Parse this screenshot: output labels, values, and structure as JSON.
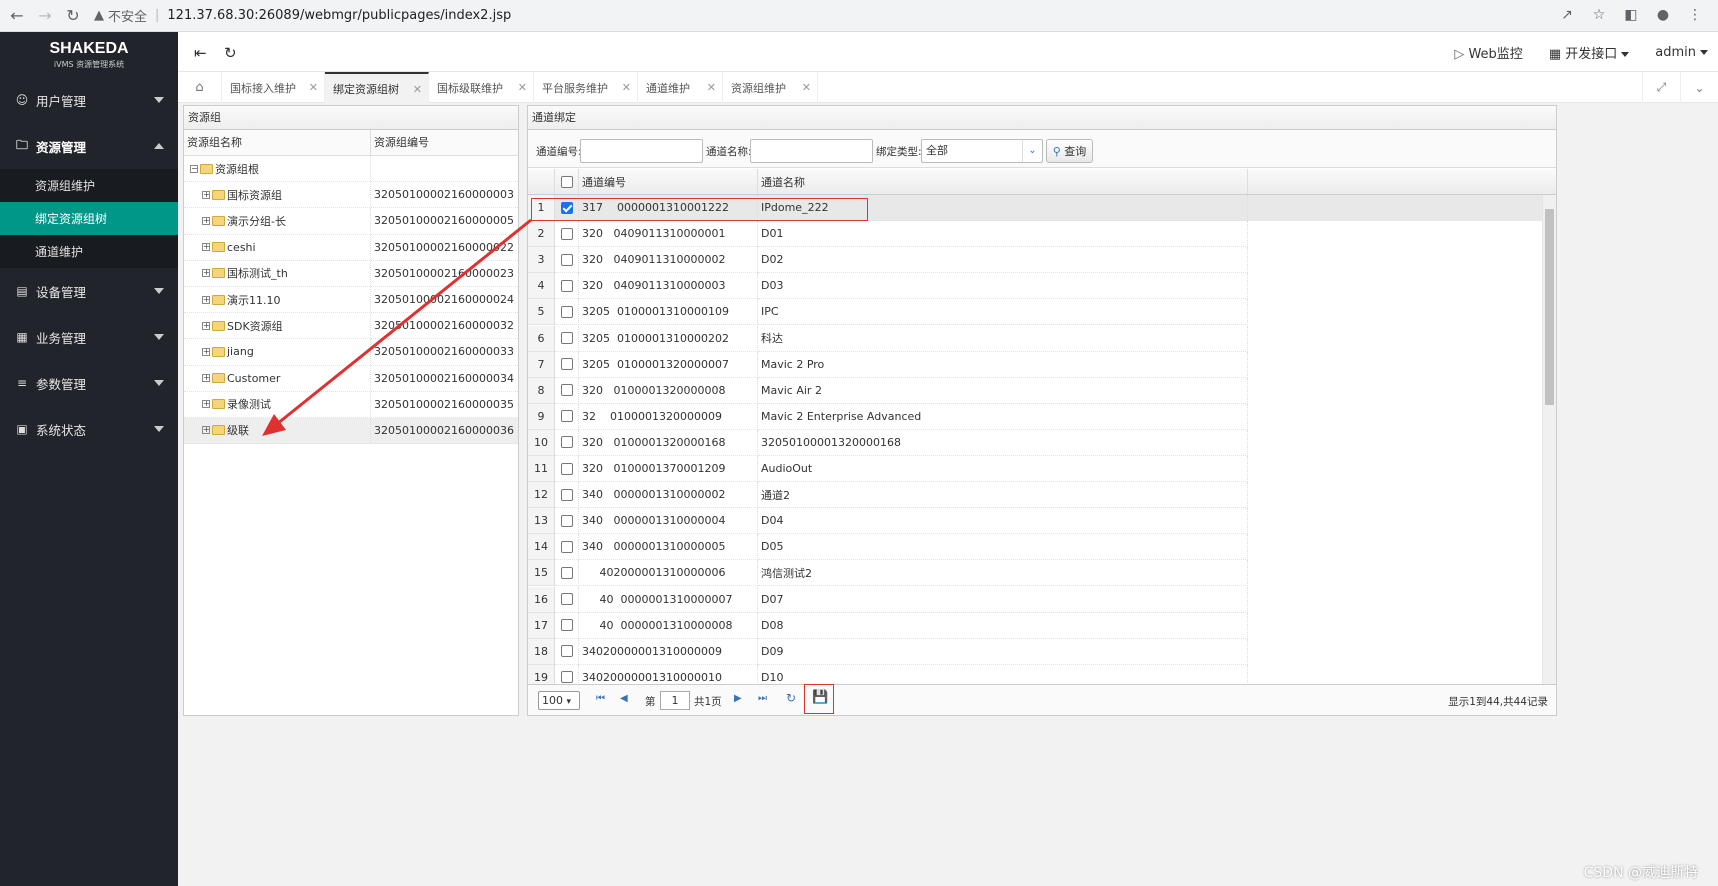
{
  "browser": {
    "insecure_label": "不安全",
    "url": "121.37.68.30:26089/webmgr/publicpages/index2.jsp"
  },
  "app": {
    "logo_main": "SHAKEDA",
    "logo_sub": "iVMS 资源管理系统"
  },
  "sidebar": {
    "items": [
      {
        "label": "用户管理",
        "icon": "user-icon",
        "expanded": false
      },
      {
        "label": "资源管理",
        "icon": "folder-icon",
        "expanded": true
      },
      {
        "label": "设备管理",
        "icon": "device-icon",
        "expanded": false
      },
      {
        "label": "业务管理",
        "icon": "business-icon",
        "expanded": false
      },
      {
        "label": "参数管理",
        "icon": "sliders-icon",
        "expanded": false
      },
      {
        "label": "系统状态",
        "icon": "monitor-icon",
        "expanded": false
      }
    ],
    "subitems": [
      {
        "label": "资源组维护",
        "selected": false
      },
      {
        "label": "绑定资源组树",
        "selected": true
      },
      {
        "label": "通道维护",
        "selected": false
      }
    ],
    "active_color": "#009688"
  },
  "topbar": {
    "web_monitor": "Web监控",
    "dev_api": "开发接口",
    "user": "admin"
  },
  "tabs": [
    {
      "label": "国标接入维护",
      "active": false
    },
    {
      "label": "绑定资源组树",
      "active": true
    },
    {
      "label": "国标级联维护",
      "active": false
    },
    {
      "label": "平台服务维护",
      "active": false
    },
    {
      "label": "通道维护",
      "active": false
    },
    {
      "label": "资源组维护",
      "active": false
    }
  ],
  "left_panel": {
    "title": "资源组",
    "col_name": "资源组名称",
    "col_code": "资源组编号",
    "root": "资源组根",
    "rows": [
      {
        "name": "国标资源组",
        "code": "32050100002160000003"
      },
      {
        "name": "演示分组-长",
        "code": "32050100002160000005"
      },
      {
        "name": "ceshi",
        "code": "32050100002160000022"
      },
      {
        "name": "国标测试_th",
        "code": "32050100002160000023"
      },
      {
        "name": "演示11.10",
        "code": "32050100002160000024"
      },
      {
        "name": "SDK资源组",
        "code": "32050100002160000032"
      },
      {
        "name": "jiang",
        "code": "32050100002160000033"
      },
      {
        "name": "Customer",
        "code": "32050100002160000034"
      },
      {
        "name": "录像测试",
        "code": "32050100002160000035"
      },
      {
        "name": "级联",
        "code": "32050100002160000036"
      }
    ]
  },
  "right_panel": {
    "title": "通道绑定",
    "filter": {
      "channel_code_label": "通道编号:",
      "channel_name_label": "通道名称:",
      "bind_type_label": "绑定类型:",
      "bind_type_value": "全部",
      "query_label": "查询"
    },
    "col_code": "通道编号",
    "col_name": "通道名称",
    "rows": [
      {
        "n": "1",
        "code": "317    0000001310001222",
        "name": "IPdome_222",
        "checked": true
      },
      {
        "n": "2",
        "code": "320   0409011310000001",
        "name": "D01",
        "checked": false
      },
      {
        "n": "3",
        "code": "320   0409011310000002",
        "name": "D02",
        "checked": false
      },
      {
        "n": "4",
        "code": "320   0409011310000003",
        "name": "D03",
        "checked": false
      },
      {
        "n": "5",
        "code": "3205  0100001310000109",
        "name": "IPC",
        "checked": false
      },
      {
        "n": "6",
        "code": "3205  0100001310000202",
        "name": "科达",
        "checked": false
      },
      {
        "n": "7",
        "code": "3205  0100001320000007",
        "name": "Mavic 2 Pro",
        "checked": false
      },
      {
        "n": "8",
        "code": "320   0100001320000008",
        "name": "Mavic Air 2",
        "checked": false
      },
      {
        "n": "9",
        "code": "32    0100001320000009",
        "name": "Mavic 2 Enterprise Advanced",
        "checked": false
      },
      {
        "n": "10",
        "code": "320   0100001320000168",
        "name": "32050100001320000168",
        "checked": false
      },
      {
        "n": "11",
        "code": "320   0100001370001209",
        "name": "AudioOut",
        "checked": false
      },
      {
        "n": "12",
        "code": "340   0000001310000002",
        "name": "通道2",
        "checked": false
      },
      {
        "n": "13",
        "code": "340   0000001310000004",
        "name": "D04",
        "checked": false
      },
      {
        "n": "14",
        "code": "340   0000001310000005",
        "name": "D05",
        "checked": false
      },
      {
        "n": "15",
        "code": "     402000001310000006",
        "name": "鸿信测试2",
        "checked": false
      },
      {
        "n": "16",
        "code": "     40  0000001310000007",
        "name": "D07",
        "checked": false
      },
      {
        "n": "17",
        "code": "     40  0000001310000008",
        "name": "D08",
        "checked": false
      },
      {
        "n": "18",
        "code": "34020000001310000009",
        "name": "D09",
        "checked": false
      },
      {
        "n": "19",
        "code": "34020000001310000010",
        "name": "D10",
        "checked": false
      }
    ],
    "pager": {
      "page_size": "100",
      "page_prefix": "第",
      "page_value": "1",
      "page_total": "共1页",
      "info": "显示1到44,共44记录"
    }
  },
  "watermark": "CSDN @威迪斯特"
}
